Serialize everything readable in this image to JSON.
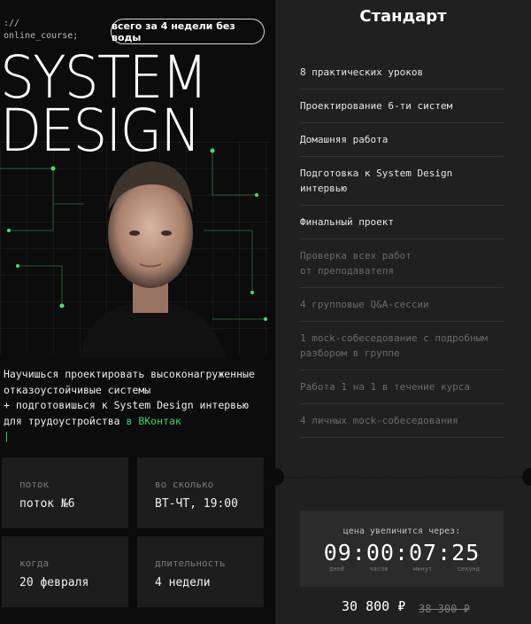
{
  "hero": {
    "prompt_line1": "://",
    "prompt_line2": "online_course;",
    "pill": "всего за 4 недели без воды",
    "title_line1": "SYSTEM",
    "title_line2": "DESIGN"
  },
  "description": {
    "text": "Научишься проектировать высоконагруженные отказоустойчивые системы\n+ подготовишься к System Design интервью для трудоустройства ",
    "highlight": "в ВКонтак",
    "caret": "|"
  },
  "cards": [
    {
      "label": "поток",
      "value": "поток №6"
    },
    {
      "label": "во сколько",
      "value": "ВТ-ЧТ, 19:00"
    },
    {
      "label": "когда",
      "value": "20 февраля"
    },
    {
      "label": "длительность",
      "value": "4 недели"
    }
  ],
  "plan": {
    "title": "Стандарт",
    "features": [
      {
        "text": "8 практических уроков",
        "included": true
      },
      {
        "text": "Проектирование 6-ти систем",
        "included": true
      },
      {
        "text": "Домашняя работа",
        "included": true
      },
      {
        "text": "Подготовка к System Design\nинтервью",
        "included": true
      },
      {
        "text": "Финальный проект",
        "included": true
      },
      {
        "text": "Проверка всех работ\nот преподавателя",
        "included": false
      },
      {
        "text": "4 групповые Q&A-сессии",
        "included": false
      },
      {
        "text": "1 mock-собеседование с подробным\nразбором в группе",
        "included": false
      },
      {
        "text": "Работа 1 на 1 в течение курса",
        "included": false
      },
      {
        "text": "4 личных mock-собеседования",
        "included": false
      }
    ],
    "timer": {
      "caption": "цена увеличится через:",
      "time": "09:00:07:25",
      "units": [
        "дней",
        "часов",
        "минут",
        "секунд"
      ]
    },
    "price": "30 800 ₽",
    "old_price": "38 300 ₽"
  },
  "colors": {
    "accent_green": "#37d06a",
    "panel": "#202020",
    "card": "#1d1d1d",
    "background": "#0b0b0b"
  }
}
